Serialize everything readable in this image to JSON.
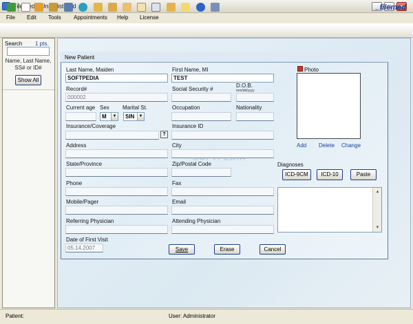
{
  "window": {
    "title": "FileMed - Unregistered",
    "minimize": "_",
    "maximize": "□",
    "close": "×"
  },
  "menu": [
    {
      "label": "File"
    },
    {
      "label": "Edit"
    },
    {
      "label": "Tools"
    },
    {
      "label": "Appointments"
    },
    {
      "label": "Help"
    },
    {
      "label": "License"
    }
  ],
  "toolbar": {
    "brand": "filemed",
    "icons": [
      "refresh-icon",
      "new-document-icon",
      "users-icon",
      "open-folder-icon",
      "print-preview-icon",
      "globe-icon",
      "folder-icon",
      "folder-open-icon",
      "edit-icon",
      "clipboard-icon",
      "magnifier-icon",
      "export-icon",
      "notes-icon",
      "help-icon",
      "info-icon"
    ]
  },
  "sidebar": {
    "search_label": "Search",
    "pts_label": "1 pts.",
    "hint": "Name, Last Name, SS# or ID#",
    "show_all": "Show All"
  },
  "form": {
    "title": "New Patient",
    "last_name_label": "Last Name, Maiden",
    "last_name_value": "SOFTPEDIA",
    "first_name_label": "First Name, MI",
    "first_name_value": "TEST",
    "photo_label": "Photo",
    "record_label": "Record#",
    "record_value": "000002",
    "ssn_label": "Social Security #",
    "dob_label": "D.O.B.",
    "dob_format": "mm/dd/yyyy",
    "age_label": "Current age",
    "sex_label": "Sex",
    "sex_value": "M",
    "marital_label": "Marital St.",
    "marital_value": "SIN",
    "occupation_label": "Occupation",
    "nationality_label": "Nationality",
    "insurance_label": "Insurance/Coverage",
    "insurance_help": "?",
    "insurance_id_label": "Insurance ID",
    "address_label": "Address",
    "city_label": "City",
    "state_label": "State/Province",
    "zip_label": "Zip/Postal Code",
    "phone_label": "Phone",
    "fax_label": "Fax",
    "mobile_label": "Mobile/Pager",
    "email_label": "Email",
    "referring_label": "Referring Physician",
    "attending_label": "Attending Physician",
    "first_visit_label": "Date of First Visit",
    "first_visit_value": "05.14.2007",
    "photo_add": "Add",
    "photo_delete": "Delete",
    "photo_change": "Change",
    "diagnoses_label": "Diagnoses",
    "icd9": "ICD-9CM",
    "icd10": "ICD-10",
    "paste": "Paste",
    "save": "Save",
    "erase": "Erase",
    "cancel": "Cancel",
    "watermark": "SOFTPEDIA"
  },
  "status": {
    "patient": "Patient:",
    "user": "User: Administrator"
  },
  "colors": {
    "accent": "#1a3fa0",
    "panel_border": "#5a7a9a",
    "field_border": "#7f9db9"
  }
}
